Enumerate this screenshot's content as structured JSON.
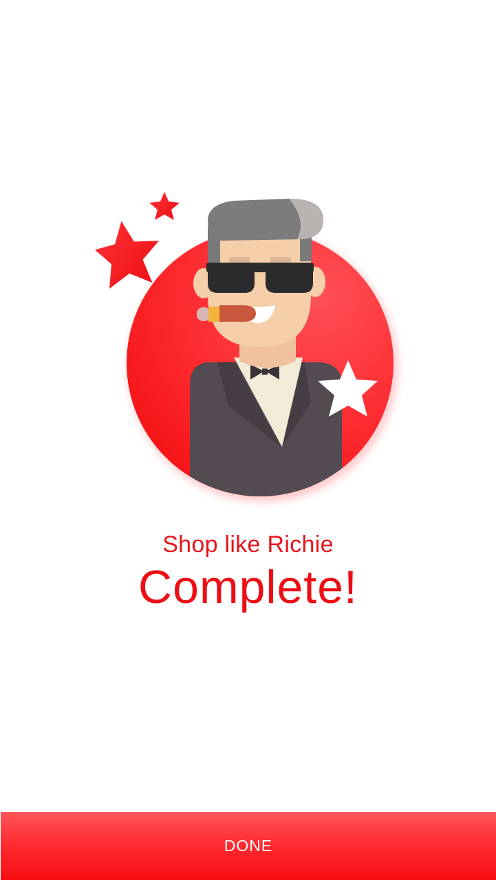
{
  "screen": {
    "illustration": "rich-man-character",
    "subtitle": "Shop like Richie",
    "title": "Complete!"
  },
  "footer": {
    "done_label": "DONE"
  },
  "colors": {
    "accent": "#ee0d14",
    "button_top": "#ff5659",
    "button_bottom": "#f80c12",
    "suit": "#544a51",
    "hair": "#7a7a7a",
    "skin": "#f5ceaa"
  }
}
